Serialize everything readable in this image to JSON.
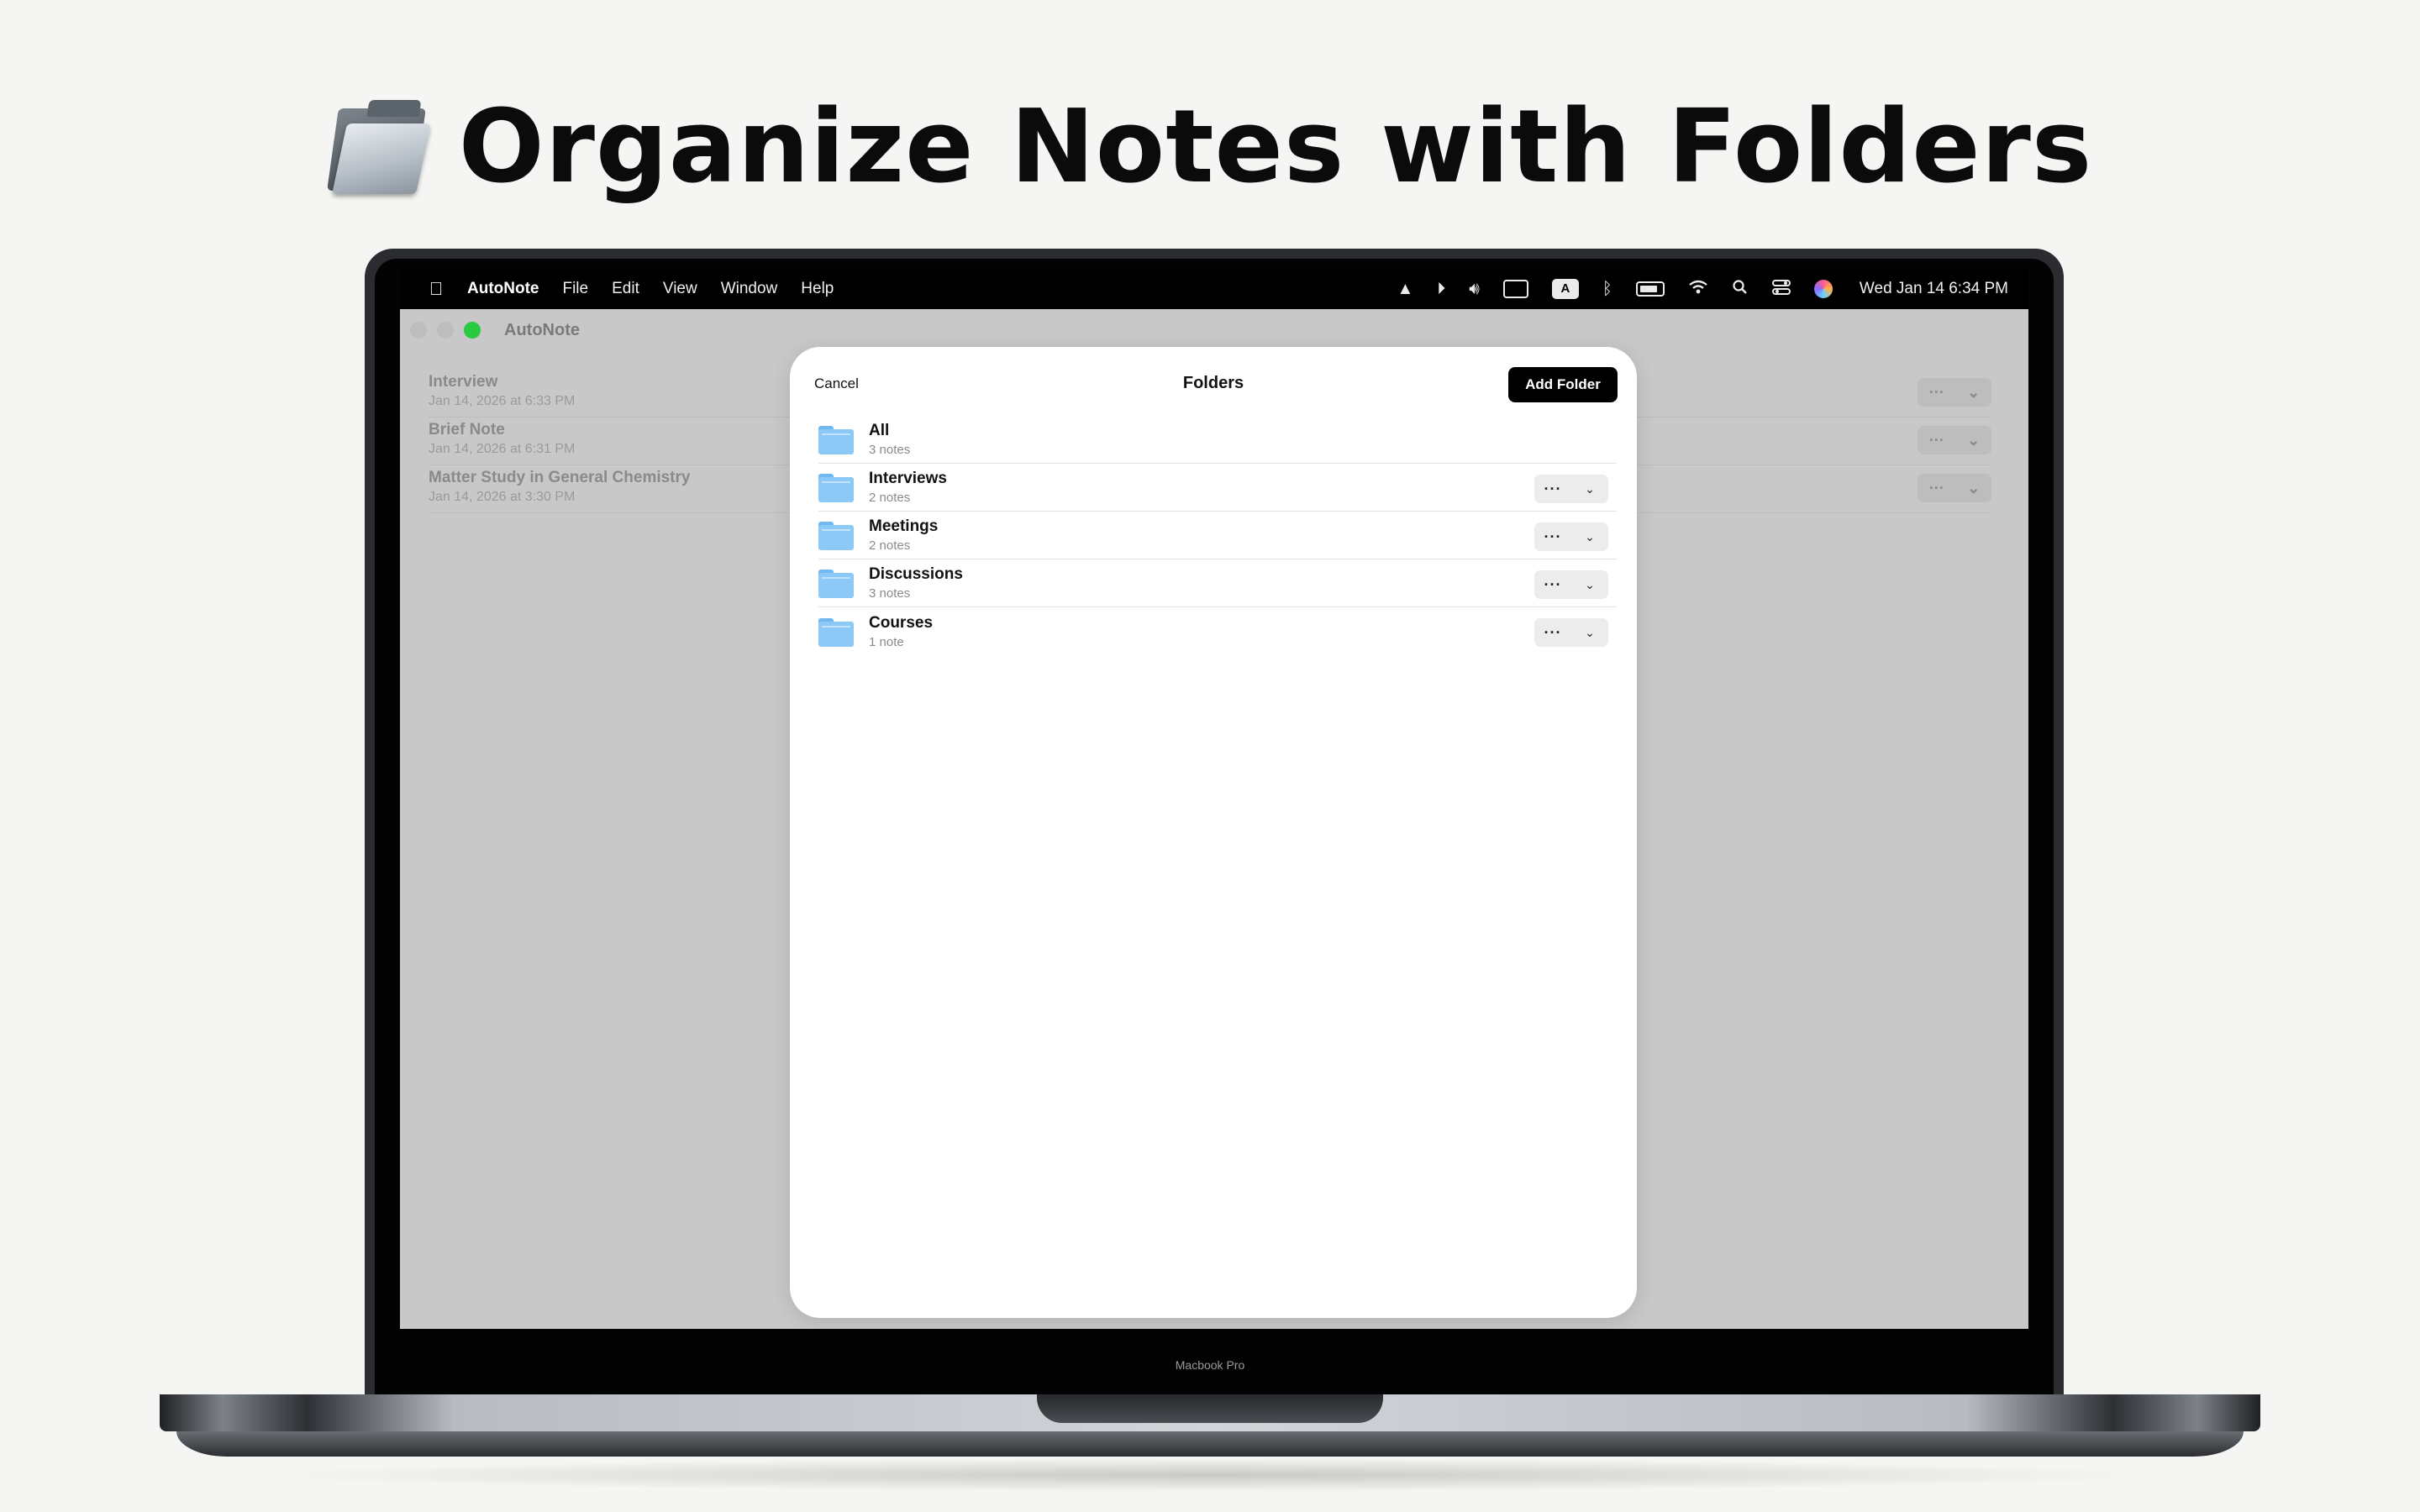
{
  "headline": {
    "icon": "folder-icon",
    "text": "Organize Notes with Folders"
  },
  "laptop": {
    "model_label": "Macbook Pro"
  },
  "menubar": {
    "apple_icon": "apple-logo-icon",
    "app_name": "AutoNote",
    "menus": [
      "File",
      "Edit",
      "View",
      "Window",
      "Help"
    ],
    "status_icons": [
      "vlc-icon",
      "play-circle-icon",
      "volume-icon",
      "display-icon",
      "input-source-icon",
      "bluetooth-icon",
      "battery-icon",
      "wifi-icon",
      "spotlight-search-icon",
      "control-center-icon",
      "siri-icon"
    ],
    "input_source_label": "A",
    "clock": "Wed Jan 14  6:34 PM"
  },
  "window": {
    "title": "AutoNote",
    "notes": [
      {
        "title": "Interview",
        "date": "Jan 14, 2026 at 6:33 PM"
      },
      {
        "title": "Brief Note",
        "date": "Jan 14, 2026 at 6:31 PM"
      },
      {
        "title": "Matter Study in General Chemistry",
        "date": "Jan 14, 2026 at 3:30 PM"
      }
    ]
  },
  "modal": {
    "cancel_label": "Cancel",
    "title": "Folders",
    "add_label": "Add Folder",
    "folders": [
      {
        "name": "All",
        "count": "3 notes"
      },
      {
        "name": "Interviews",
        "count": "2 notes"
      },
      {
        "name": "Meetings",
        "count": "2 notes"
      },
      {
        "name": "Discussions",
        "count": "3 notes"
      },
      {
        "name": "Courses",
        "count": "1 note"
      }
    ],
    "more_glyph": "···",
    "chevron_glyph": "⌄"
  },
  "colors": {
    "background": "#f5f5f3",
    "accent_button": "#000000",
    "folder_blue": "#8dc9f6",
    "zoom_green": "#29c940"
  }
}
